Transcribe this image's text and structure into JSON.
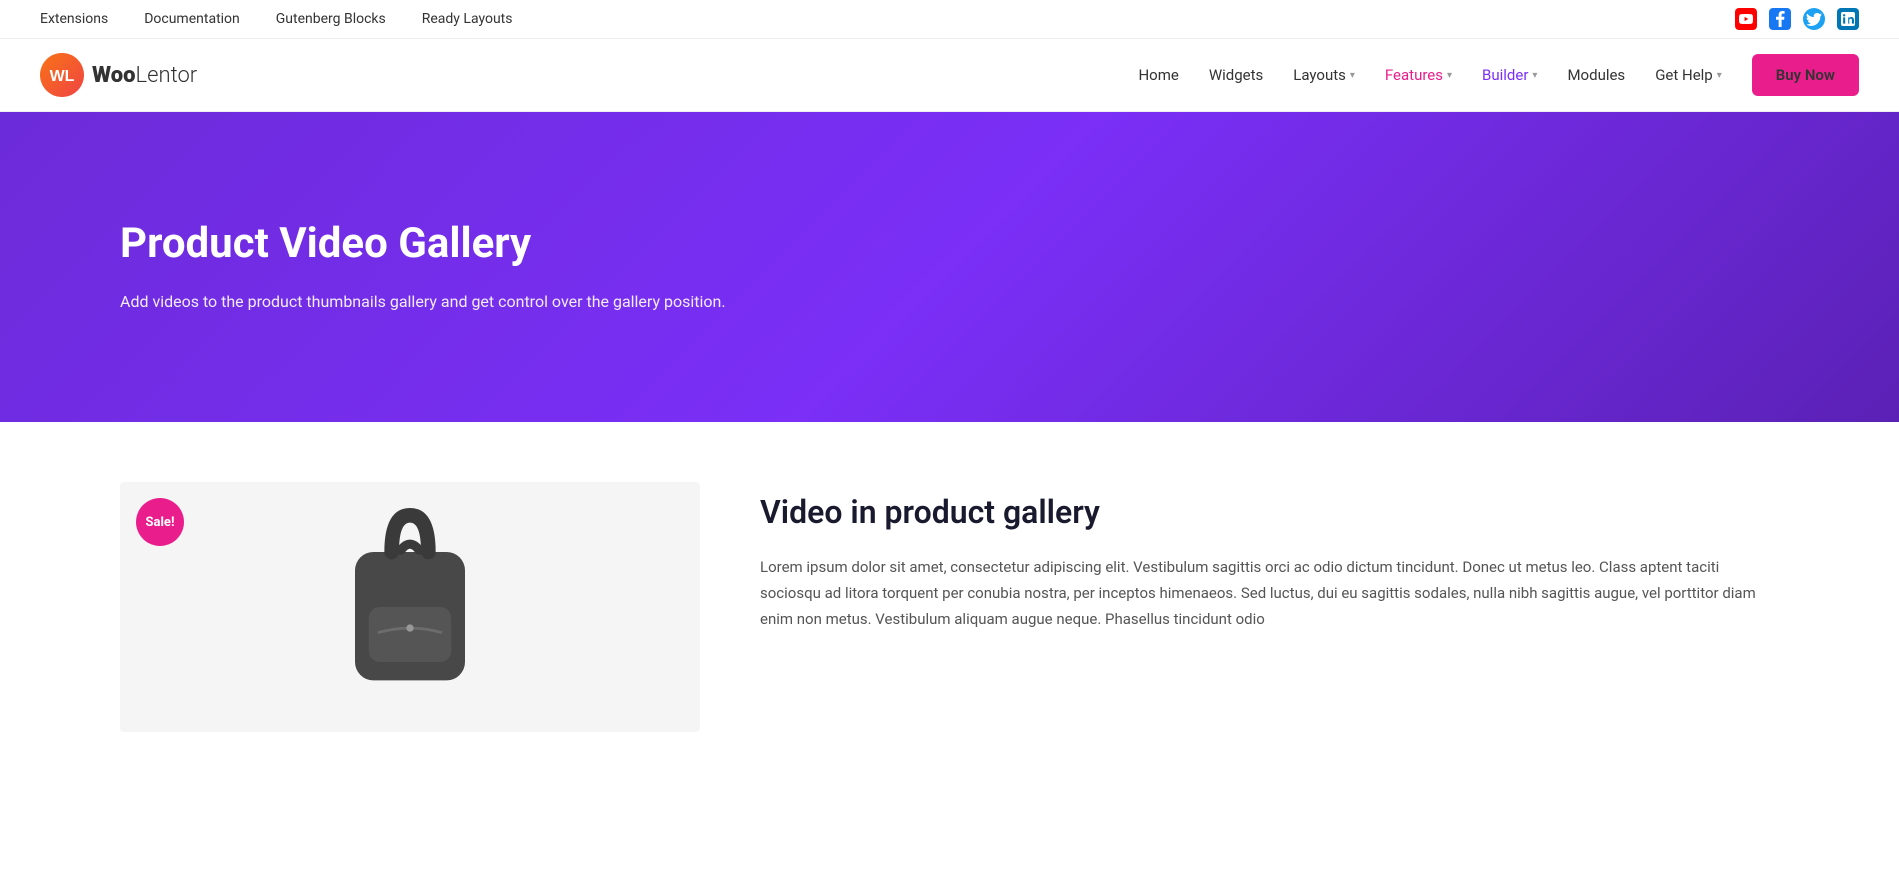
{
  "topbar": {
    "nav": [
      {
        "label": "Extensions",
        "href": "#"
      },
      {
        "label": "Documentation",
        "href": "#"
      },
      {
        "label": "Gutenberg Blocks",
        "href": "#"
      },
      {
        "label": "Ready Layouts",
        "href": "#"
      }
    ],
    "social": [
      {
        "name": "youtube",
        "symbol": "▶",
        "class": "social-yt"
      },
      {
        "name": "facebook",
        "symbol": "f",
        "class": "social-fb"
      },
      {
        "name": "twitter",
        "symbol": "🐦",
        "class": "social-tw"
      },
      {
        "name": "linkedin",
        "symbol": "in",
        "class": "social-li"
      }
    ]
  },
  "mainnav": {
    "logo_initials": "WL",
    "logo_bold": "Woo",
    "logo_light": "Lentor",
    "links": [
      {
        "label": "Home",
        "style": "normal"
      },
      {
        "label": "Widgets",
        "style": "normal"
      },
      {
        "label": "Layouts",
        "style": "normal",
        "dropdown": true
      },
      {
        "label": "Features",
        "style": "pink",
        "dropdown": true
      },
      {
        "label": "Builder",
        "style": "purple",
        "dropdown": true
      },
      {
        "label": "Modules",
        "style": "normal"
      },
      {
        "label": "Get Help",
        "style": "normal",
        "dropdown": true
      }
    ],
    "cta_label": "Buy Now"
  },
  "hero": {
    "title": "Product Video Gallery",
    "subtitle": "Add videos to the product thumbnails gallery and get control over the gallery position."
  },
  "content": {
    "product_section_title": "Video in product gallery",
    "sale_badge": "Sale!",
    "body_text": "Lorem ipsum dolor sit amet, consectetur adipiscing elit. Vestibulum sagittis orci ac odio dictum tincidunt. Donec ut metus leo. Class aptent taciti sociosqu ad litora torquent per conubia nostra, per inceptos himenaeos. Sed luctus, dui eu sagittis sodales, nulla nibh sagittis augue, vel porttitor diam enim non metus. Vestibulum aliquam augue neque. Phasellus tincidunt odio"
  }
}
